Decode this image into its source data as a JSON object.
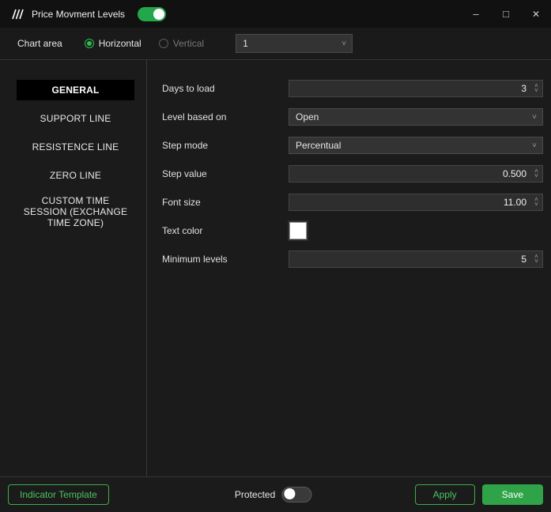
{
  "window": {
    "title": "Price Movment Levels",
    "enabled_toggle_on": true,
    "controls": {
      "minimize": "–",
      "maximize": "□",
      "close": "✕"
    }
  },
  "header": {
    "chart_area_label": "Chart area",
    "radios": [
      {
        "label": "Horizontal",
        "selected": true
      },
      {
        "label": "Vertical",
        "selected": false
      }
    ],
    "chart_select_value": "1"
  },
  "sidebar": {
    "items": [
      {
        "label": "GENERAL",
        "selected": true
      },
      {
        "label": "SUPPORT LINE",
        "selected": false
      },
      {
        "label": "RESISTENCE LINE",
        "selected": false
      },
      {
        "label": "ZERO LINE",
        "selected": false
      },
      {
        "label": "CUSTOM TIME SESSION (EXCHANGE TIME ZONE)",
        "selected": false
      }
    ]
  },
  "form": {
    "fields": [
      {
        "label": "Days to load",
        "type": "stepper",
        "value": "3"
      },
      {
        "label": "Level based on",
        "type": "select",
        "value": "Open"
      },
      {
        "label": "Step mode",
        "type": "select",
        "value": "Percentual"
      },
      {
        "label": "Step value",
        "type": "stepper",
        "value": "0.500"
      },
      {
        "label": "Font size",
        "type": "stepper",
        "value": "11.00"
      },
      {
        "label": "Text color",
        "type": "color",
        "value": "#FFFFFF"
      },
      {
        "label": "Minimum levels",
        "type": "stepper",
        "value": "5"
      }
    ]
  },
  "footer": {
    "indicator_template_label": "Indicator Template",
    "protected_label": "Protected",
    "protected_on": false,
    "apply_label": "Apply",
    "save_label": "Save"
  },
  "icons": {
    "chevron_up": "˄",
    "chevron_down": "˅",
    "select_chevron": "˅"
  },
  "colors": {
    "accent_green": "#2EA84A",
    "save_button_green": "#2F9E44",
    "selected_tab_bg": "#000000",
    "input_bg": "#2E2E2E",
    "text_color_value": "#FFFFFF"
  }
}
